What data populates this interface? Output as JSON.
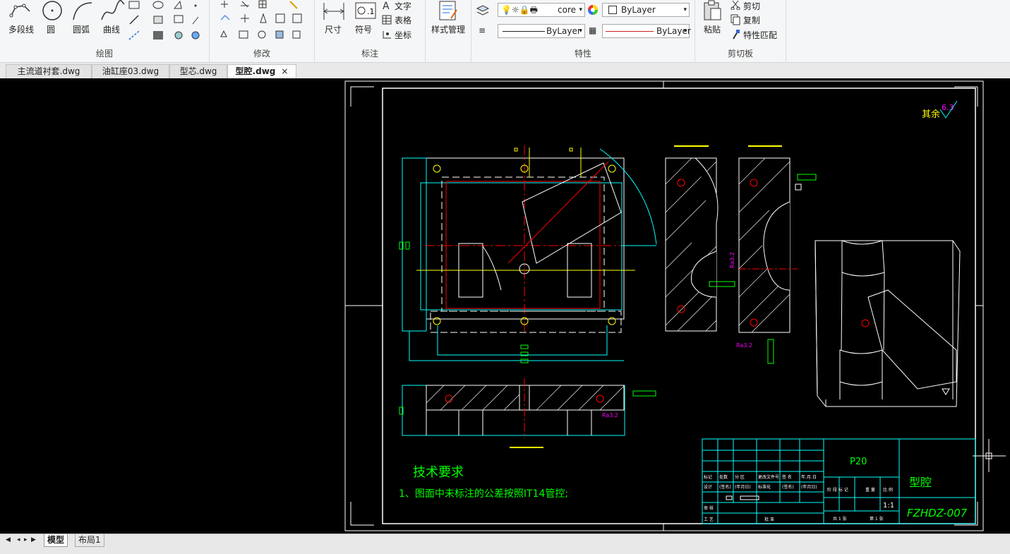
{
  "ribbon": {
    "draw": {
      "title": "绘图",
      "polyline": "多段线",
      "circle": "圆",
      "arc": "圆弧",
      "curve": "曲线"
    },
    "modify": {
      "title": "修改"
    },
    "annotate": {
      "title": "标注",
      "dimension": "尺寸",
      "symbol": "符号",
      "text": "文字",
      "table": "表格",
      "coord": "坐标"
    },
    "style": {
      "label": "样式管理"
    },
    "properties": {
      "title": "特性",
      "layer_value": "core",
      "color_value": "ByLayer",
      "linetype_value": "ByLayer",
      "lineweight_value": "ByLayer"
    },
    "clipboard": {
      "title": "剪切板",
      "paste": "粘贴",
      "cut": "剪切",
      "copy": "复制",
      "match": "特性匹配"
    }
  },
  "tabs": [
    {
      "label": "主流道衬套.dwg"
    },
    {
      "label": "油缸座03.dwg"
    },
    {
      "label": "型芯.dwg"
    },
    {
      "label": "型腔.dwg"
    }
  ],
  "drawing": {
    "roughness_other": "其余",
    "roughness_value": "6.3",
    "tech_title": "技术要求",
    "tech_note": "1、图面中未标注的公差按照IT14管控;",
    "material": "P20",
    "part_name": "型腔",
    "drawing_no": "FZHDZ-007",
    "scale": "1:1",
    "ra1": "Ra3.2",
    "ra2": "Ra3.2",
    "ra3": "Ra3.2",
    "tb_labels": [
      "标记",
      "处数",
      "分 区",
      "更改文件号",
      "签 名",
      "年.月.日",
      "设计",
      "(签名)",
      "(年月日)",
      "标准化",
      "(签名)",
      "(年月日)",
      "阶 段 标 记",
      "重 量",
      "比 例",
      "审 核",
      "工 艺",
      "批 准",
      "共 1 张",
      "第 1 张"
    ]
  },
  "layout_tabs": {
    "model": "模型",
    "layout1": "布局1"
  },
  "colors": {
    "background": "#000000",
    "green": "#00ff00",
    "yellow": "#ffff00",
    "cyan": "#00ffff",
    "red": "#ff0000",
    "magenta": "#ff00ff",
    "white": "#ffffff"
  }
}
